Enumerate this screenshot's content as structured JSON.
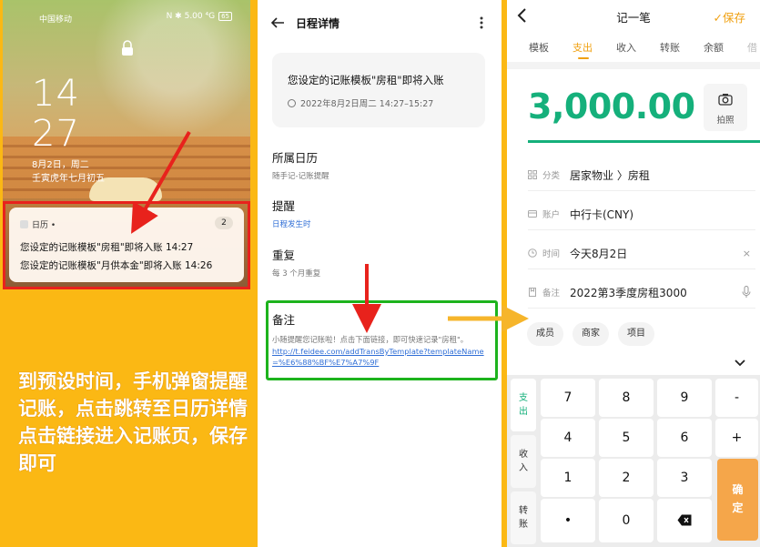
{
  "lockscreen": {
    "carrier": "中国移动",
    "status_icons": "N ✱ 5.00 ⁴G",
    "battery": "65",
    "time_hour": "14",
    "time_min": "27",
    "date": "8月2日，周二",
    "lunar": "壬寅虎年七月初五",
    "notification": {
      "app_name": "日历 •",
      "count": "2",
      "lines": [
        "您设定的记账模板\"房租\"即将入账 14:27",
        "您设定的记账模板\"月供本金\"即将入账 14:26"
      ]
    }
  },
  "caption": "到预设时间，手机弹窗提醒记账，点击跳转至日历详情点击链接进入记账页，保存即可",
  "detail": {
    "title": "日程详情",
    "event_name": "您设定的记账模板\"房租\"即将入账",
    "event_time": "2022年8月2日周二 14:27–15:27",
    "calendar_label": "所属日历",
    "calendar_value": "随手记-记账提醒",
    "reminder_label": "提醒",
    "reminder_value": "日程发生时",
    "repeat_label": "重复",
    "repeat_value": "每 3 个月重复",
    "note_label": "备注",
    "note_text": "小随提醒您记账啦！点击下面链接，即可快速记录\"房租\"。",
    "note_link": "http://t.feidee.com/addTransByTemplate?templateName=%E6%88%BF%E7%A7%9F"
  },
  "bookkeeping": {
    "title": "记一笔",
    "save_label": "保存",
    "tabs": [
      "模板",
      "支出",
      "收入",
      "转账",
      "余额",
      "借"
    ],
    "active_tab": "支出",
    "amount": "3,000.00",
    "photo_label": "拍照",
    "fields": [
      {
        "key": "分类",
        "value": "居家物业 〉房租",
        "icon": "category-icon"
      },
      {
        "key": "账户",
        "value": "中行卡(CNY)",
        "icon": "card-icon"
      },
      {
        "key": "时间",
        "value": "今天8月2日",
        "icon": "clock-icon"
      },
      {
        "key": "备注",
        "value": "2022第3季度房租3000",
        "icon": "note-icon"
      }
    ],
    "time_clear": "×",
    "chips": [
      "成员",
      "商家",
      "项目"
    ],
    "type_buttons": [
      "支\n出",
      "收\n入",
      "转\n账"
    ],
    "keys": [
      "7",
      "8",
      "9",
      "-",
      "4",
      "5",
      "6",
      "+",
      "1",
      "2",
      "3",
      "•",
      "0"
    ],
    "confirm_label": "确\n定",
    "colors": {
      "accent": "#f0a010",
      "amount": "#15b07b",
      "confirm": "#f5a64a"
    }
  }
}
